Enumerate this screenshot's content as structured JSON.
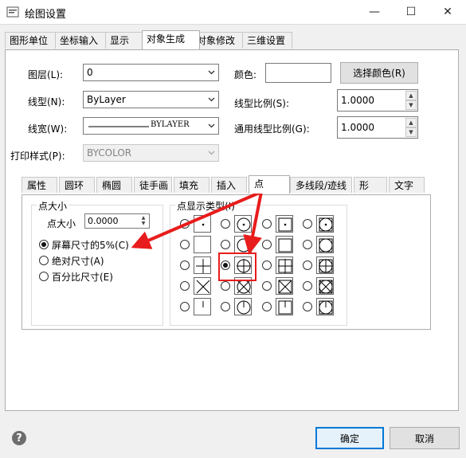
{
  "window": {
    "title": "绘图设置",
    "help_label": "?",
    "minimize_label": "—",
    "maximize_label": "☐",
    "close_label": "✕"
  },
  "tabs": [
    "图形单位",
    "坐标输入",
    "显示",
    "对象生成",
    "对象修改",
    "三维设置"
  ],
  "active_tab": "对象生成",
  "form": {
    "layer_label": "图层(L):",
    "layer_value": "0",
    "linetype_label": "线型(N):",
    "linetype_value": "ByLayer",
    "linewidth_label": "线宽(W):",
    "linewidth_value": "BYLAYER",
    "plotstyle_label": "打印样式(P):",
    "plotstyle_value": "BYCOLOR",
    "color_label": "颜色:",
    "choose_color_label": "选择颜色(R)",
    "linetype_scale_label": "线型比例(S):",
    "linetype_scale_value": "1.0000",
    "global_scale_label": "通用线型比例(G):",
    "global_scale_value": "1.0000"
  },
  "subtabs": [
    "属性",
    "圆环",
    "椭圆",
    "徒手画",
    "填充",
    "插入",
    "点",
    "多线段/迹线",
    "形",
    "文字"
  ],
  "active_subtab": "点",
  "point_size": {
    "group_title": "点大小",
    "size_label": "点大小",
    "size_value": "0.0000",
    "options": [
      "屏幕尺寸的5%(C)",
      "绝对尺寸(A)",
      "百分比尺寸(E)"
    ],
    "selected_option": 0
  },
  "point_display": {
    "group_title": "点显示类型(I)",
    "rows": 5,
    "cols": 4,
    "selected": {
      "row": 2,
      "col": 1
    }
  },
  "buttons": {
    "ok": "确定",
    "cancel": "取消"
  },
  "annotation_color": "#e81c1c",
  "accent_color": "#0078d7"
}
